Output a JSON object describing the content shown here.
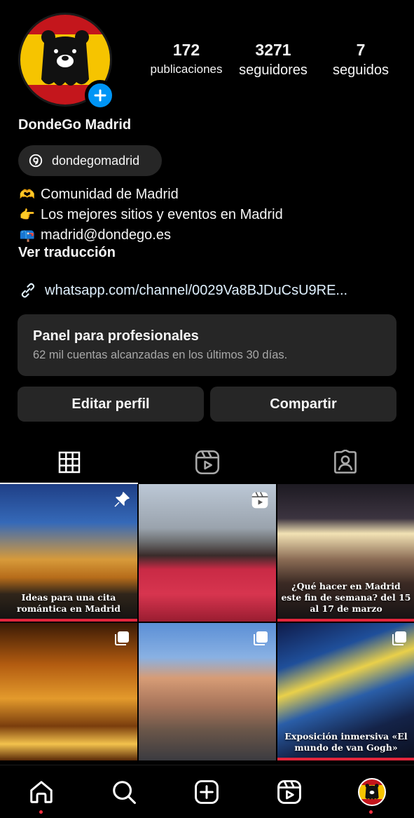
{
  "profile": {
    "name": "DondeGo Madrid",
    "threads_handle": "dondegomadrid",
    "stats": [
      {
        "value": "172",
        "label": "publicaciones"
      },
      {
        "value": "3271",
        "label": "seguidores"
      },
      {
        "value": "7",
        "label": "seguidos"
      }
    ],
    "bio": [
      {
        "emoji": "🫶",
        "text": "Comunidad de Madrid"
      },
      {
        "emoji": "👉",
        "text": "Los mejores sitios y eventos en Madrid"
      },
      {
        "emoji": "📪",
        "text": "madrid@dondego.es"
      }
    ],
    "see_translation": "Ver traducción",
    "link": "whatsapp.com/channel/0029Va8BJDuCsU9RE..."
  },
  "pro_panel": {
    "title": "Panel para profesionales",
    "subtitle": "62 mil cuentas alcanzadas en los últimos 30 días."
  },
  "buttons": {
    "edit": "Editar perfil",
    "share": "Compartir"
  },
  "tabs": [
    {
      "icon": "grid-icon",
      "active": true
    },
    {
      "icon": "reels-icon",
      "active": false
    },
    {
      "icon": "tagged-icon",
      "active": false
    }
  ],
  "posts": [
    {
      "caption": "Ideas para una cita romántica en Madrid",
      "overlay": "pin-icon"
    },
    {
      "caption": "",
      "overlay": "reel-icon"
    },
    {
      "caption": "¿Qué hacer en Madrid este fin de semana? del 15 al 17 de marzo",
      "overlay": ""
    },
    {
      "caption": "",
      "overlay": "carousel-icon"
    },
    {
      "caption": "",
      "overlay": "carousel-icon"
    },
    {
      "caption": "Exposición inmersiva «El mundo de van Gogh»",
      "overlay": "carousel-icon"
    }
  ],
  "bottom_nav": [
    "home-icon",
    "search-icon",
    "create-icon",
    "reels-icon",
    "profile-avatar"
  ],
  "colors": {
    "background": "#000000",
    "surface": "#262626",
    "accent_blue": "#0095f6",
    "notification_red": "#ff3040"
  }
}
